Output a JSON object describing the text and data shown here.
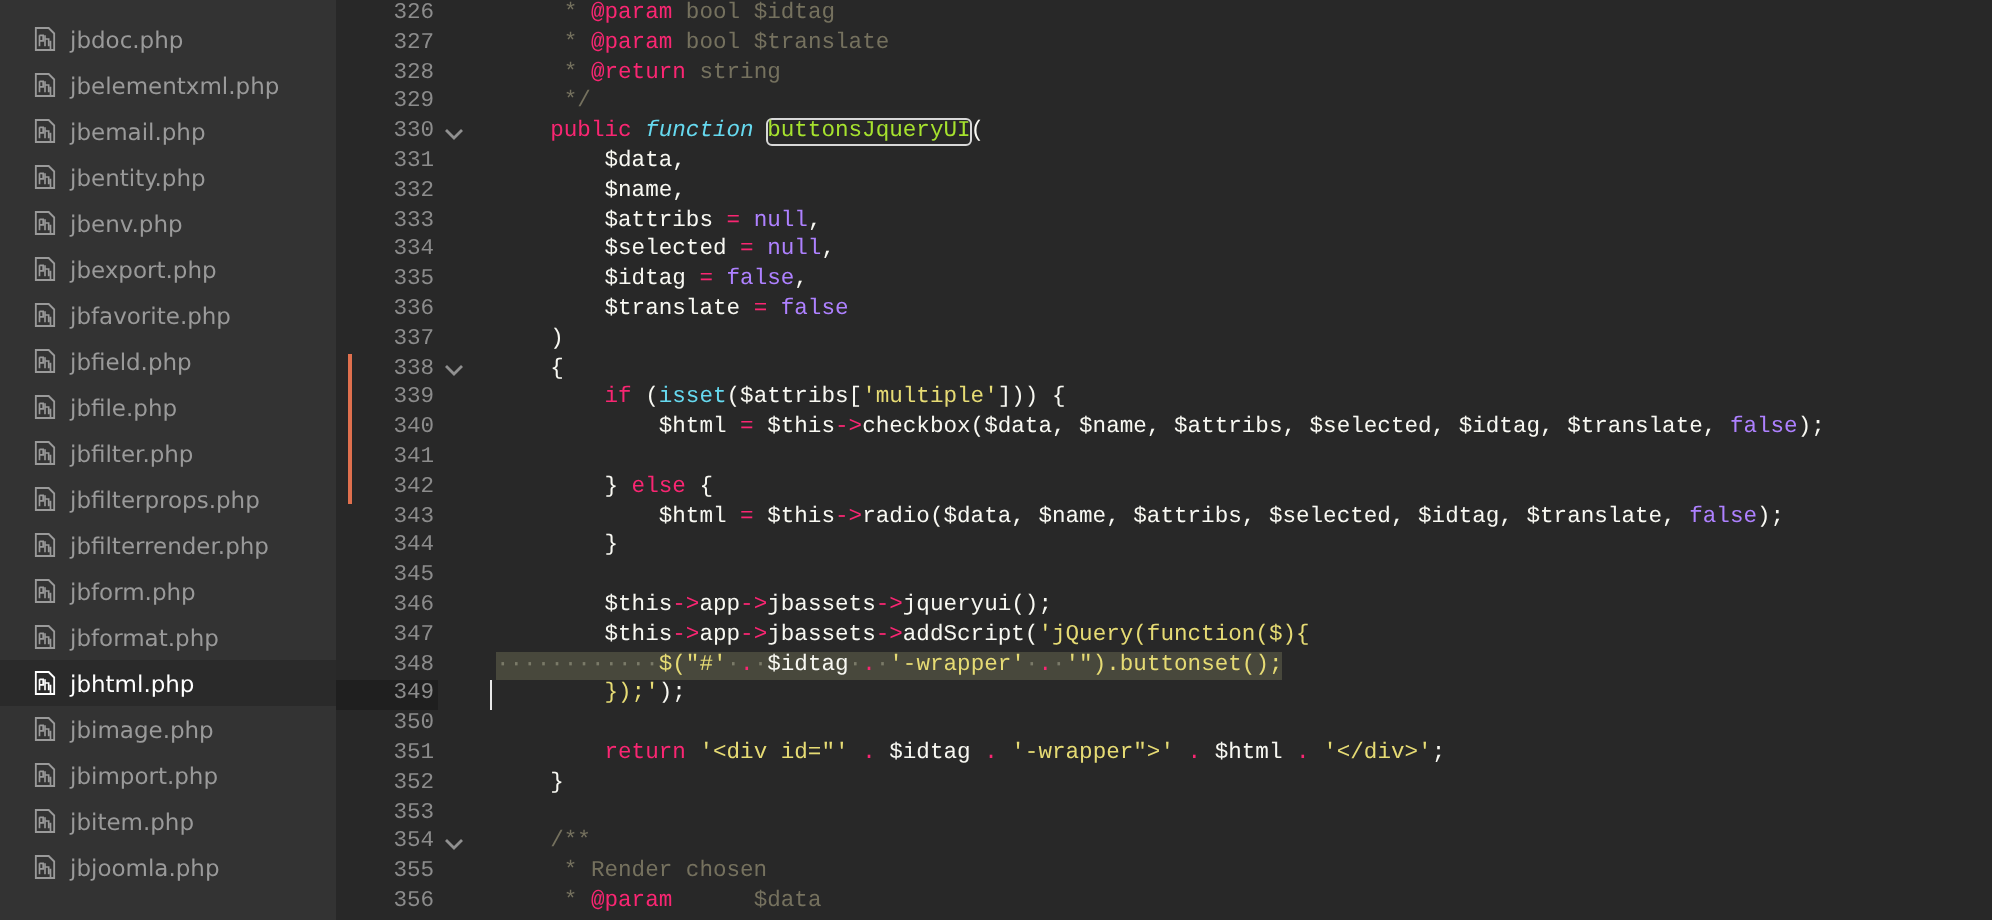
{
  "sidebar": {
    "items": [
      {
        "label": "jbdoc.php",
        "selected": false
      },
      {
        "label": "jbelementxml.php",
        "selected": false
      },
      {
        "label": "jbemail.php",
        "selected": false
      },
      {
        "label": "jbentity.php",
        "selected": false
      },
      {
        "label": "jbenv.php",
        "selected": false
      },
      {
        "label": "jbexport.php",
        "selected": false
      },
      {
        "label": "jbfavorite.php",
        "selected": false
      },
      {
        "label": "jbfield.php",
        "selected": false
      },
      {
        "label": "jbfile.php",
        "selected": false
      },
      {
        "label": "jbfilter.php",
        "selected": false
      },
      {
        "label": "jbfilterprops.php",
        "selected": false
      },
      {
        "label": "jbfilterrender.php",
        "selected": false
      },
      {
        "label": "jbform.php",
        "selected": false
      },
      {
        "label": "jbformat.php",
        "selected": false
      },
      {
        "label": "jbhtml.php",
        "selected": true
      },
      {
        "label": "jbimage.php",
        "selected": false
      },
      {
        "label": "jbimport.php",
        "selected": false
      },
      {
        "label": "jbitem.php",
        "selected": false
      },
      {
        "label": "jbjoomla.php",
        "selected": false
      }
    ]
  },
  "editor": {
    "lines": [
      {
        "number": "326",
        "fold": false,
        "modified": false,
        "selected": false,
        "current": false,
        "tokens": [
          {
            "kind": "comment",
            "text": "     * "
          },
          {
            "kind": "doctag",
            "text": "@param"
          },
          {
            "kind": "comment",
            "text": " bool $idtag"
          }
        ]
      },
      {
        "number": "327",
        "fold": false,
        "modified": false,
        "selected": false,
        "current": false,
        "tokens": [
          {
            "kind": "comment",
            "text": "     * "
          },
          {
            "kind": "doctag",
            "text": "@param"
          },
          {
            "kind": "comment",
            "text": " bool $translate"
          }
        ]
      },
      {
        "number": "328",
        "fold": false,
        "modified": false,
        "selected": false,
        "current": false,
        "tokens": [
          {
            "kind": "comment",
            "text": "     * "
          },
          {
            "kind": "doctag",
            "text": "@return"
          },
          {
            "kind": "comment",
            "text": " string"
          }
        ]
      },
      {
        "number": "329",
        "fold": false,
        "modified": false,
        "selected": false,
        "current": false,
        "tokens": [
          {
            "kind": "comment",
            "text": "     */"
          }
        ]
      },
      {
        "number": "330",
        "fold": true,
        "modified": false,
        "selected": false,
        "current": false,
        "tokens": [
          {
            "kind": "keyword",
            "text": "    public "
          },
          {
            "kind": "storage",
            "text": "function "
          },
          {
            "kind": "function",
            "text": "buttonsJqueryUI"
          },
          {
            "kind": "plain",
            "text": "("
          }
        ]
      },
      {
        "number": "331",
        "fold": false,
        "modified": false,
        "selected": false,
        "current": false,
        "tokens": [
          {
            "kind": "plain",
            "text": "        $data,"
          }
        ]
      },
      {
        "number": "332",
        "fold": false,
        "modified": false,
        "selected": false,
        "current": false,
        "tokens": [
          {
            "kind": "plain",
            "text": "        $name,"
          }
        ]
      },
      {
        "number": "333",
        "fold": false,
        "modified": false,
        "selected": false,
        "current": false,
        "tokens": [
          {
            "kind": "plain",
            "text": "        $attribs "
          },
          {
            "kind": "operator",
            "text": "= "
          },
          {
            "kind": "constant",
            "text": "null"
          },
          {
            "kind": "plain",
            "text": ","
          }
        ]
      },
      {
        "number": "334",
        "fold": false,
        "modified": false,
        "selected": false,
        "current": false,
        "tokens": [
          {
            "kind": "plain",
            "text": "        $selected "
          },
          {
            "kind": "operator",
            "text": "= "
          },
          {
            "kind": "constant",
            "text": "null"
          },
          {
            "kind": "plain",
            "text": ","
          }
        ]
      },
      {
        "number": "335",
        "fold": false,
        "modified": false,
        "selected": false,
        "current": false,
        "tokens": [
          {
            "kind": "plain",
            "text": "        $idtag "
          },
          {
            "kind": "operator",
            "text": "= "
          },
          {
            "kind": "constant",
            "text": "false"
          },
          {
            "kind": "plain",
            "text": ","
          }
        ]
      },
      {
        "number": "336",
        "fold": false,
        "modified": false,
        "selected": false,
        "current": false,
        "tokens": [
          {
            "kind": "plain",
            "text": "        $translate "
          },
          {
            "kind": "operator",
            "text": "= "
          },
          {
            "kind": "constant",
            "text": "false"
          }
        ]
      },
      {
        "number": "337",
        "fold": false,
        "modified": false,
        "selected": false,
        "current": false,
        "tokens": [
          {
            "kind": "plain",
            "text": "    )"
          }
        ]
      },
      {
        "number": "338",
        "fold": true,
        "modified": true,
        "selected": false,
        "current": false,
        "tokens": [
          {
            "kind": "plain",
            "text": "    {"
          }
        ]
      },
      {
        "number": "339",
        "fold": false,
        "modified": true,
        "selected": false,
        "current": false,
        "tokens": [
          {
            "kind": "keyword",
            "text": "        if "
          },
          {
            "kind": "plain",
            "text": "("
          },
          {
            "kind": "support",
            "text": "isset"
          },
          {
            "kind": "plain",
            "text": "($attribs["
          },
          {
            "kind": "string",
            "text": "'multiple'"
          },
          {
            "kind": "plain",
            "text": "])) {"
          }
        ]
      },
      {
        "number": "340",
        "fold": false,
        "modified": true,
        "selected": false,
        "current": false,
        "tokens": [
          {
            "kind": "plain",
            "text": "            $html "
          },
          {
            "kind": "operator",
            "text": "="
          },
          {
            "kind": "plain",
            "text": " $this"
          },
          {
            "kind": "operator",
            "text": "->"
          },
          {
            "kind": "plain",
            "text": "checkbox($data, $name, $attribs, $selected, $idtag, $translate, "
          },
          {
            "kind": "constant",
            "text": "false"
          },
          {
            "kind": "plain",
            "text": ");"
          }
        ]
      },
      {
        "number": "341",
        "fold": false,
        "modified": true,
        "selected": false,
        "current": false
      },
      {
        "number": "342",
        "fold": false,
        "modified": true,
        "selected": false,
        "current": false,
        "tokens": [
          {
            "kind": "plain",
            "text": "        } "
          },
          {
            "kind": "keyword",
            "text": "else"
          },
          {
            "kind": "plain",
            "text": " {"
          }
        ]
      },
      {
        "number": "343",
        "fold": false,
        "modified": false,
        "selected": false,
        "current": false,
        "tokens": [
          {
            "kind": "plain",
            "text": "            $html "
          },
          {
            "kind": "operator",
            "text": "="
          },
          {
            "kind": "plain",
            "text": " $this"
          },
          {
            "kind": "operator",
            "text": "->"
          },
          {
            "kind": "plain",
            "text": "radio($data, $name, $attribs, $selected, $idtag, $translate, "
          },
          {
            "kind": "constant",
            "text": "false"
          },
          {
            "kind": "plain",
            "text": ");"
          }
        ]
      },
      {
        "number": "344",
        "fold": false,
        "modified": false,
        "selected": false,
        "current": false,
        "tokens": [
          {
            "kind": "plain",
            "text": "        }"
          }
        ]
      },
      {
        "number": "345",
        "fold": false,
        "modified": false,
        "selected": false,
        "current": false
      },
      {
        "number": "346",
        "fold": false,
        "modified": false,
        "selected": false,
        "current": false,
        "tokens": [
          {
            "kind": "plain",
            "text": "        $this"
          },
          {
            "kind": "operator",
            "text": "->"
          },
          {
            "kind": "plain",
            "text": "app"
          },
          {
            "kind": "operator",
            "text": "->"
          },
          {
            "kind": "plain",
            "text": "jbassets"
          },
          {
            "kind": "operator",
            "text": "->"
          },
          {
            "kind": "plain",
            "text": "jqueryui();"
          }
        ]
      },
      {
        "number": "347",
        "fold": false,
        "modified": false,
        "selected": false,
        "current": false,
        "tokens": [
          {
            "kind": "plain",
            "text": "        $this"
          },
          {
            "kind": "operator",
            "text": "->"
          },
          {
            "kind": "plain",
            "text": "app"
          },
          {
            "kind": "operator",
            "text": "->"
          },
          {
            "kind": "plain",
            "text": "jbassets"
          },
          {
            "kind": "operator",
            "text": "->"
          },
          {
            "kind": "plain",
            "text": "addScript("
          },
          {
            "kind": "string",
            "text": "'jQuery(function($){"
          }
        ]
      },
      {
        "number": "348",
        "fold": false,
        "modified": false,
        "selected": true,
        "current": false,
        "tokens": [
          {
            "kind": "whitespace",
            "text": "············"
          },
          {
            "kind": "string",
            "text": "$(\"#'"
          },
          {
            "kind": "whitespace",
            "text": "·"
          },
          {
            "kind": "operator",
            "text": "."
          },
          {
            "kind": "whitespace",
            "text": "·"
          },
          {
            "kind": "plain",
            "text": "$idtag"
          },
          {
            "kind": "whitespace",
            "text": "·"
          },
          {
            "kind": "operator",
            "text": "."
          },
          {
            "kind": "whitespace",
            "text": "·"
          },
          {
            "kind": "string",
            "text": "'-wrapper'"
          },
          {
            "kind": "whitespace",
            "text": "·"
          },
          {
            "kind": "operator",
            "text": "."
          },
          {
            "kind": "whitespace",
            "text": "·"
          },
          {
            "kind": "string",
            "text": "'\").buttonset();"
          }
        ]
      },
      {
        "number": "349",
        "fold": false,
        "modified": false,
        "selected": false,
        "current": true,
        "tokens": [
          {
            "kind": "string",
            "text": "        });'"
          },
          {
            "kind": "plain",
            "text": ");"
          }
        ]
      },
      {
        "number": "350",
        "fold": false,
        "modified": false,
        "selected": false,
        "current": false
      },
      {
        "number": "351",
        "fold": false,
        "modified": false,
        "selected": false,
        "current": false,
        "tokens": [
          {
            "kind": "keyword",
            "text": "        return "
          },
          {
            "kind": "string",
            "text": "'<div id=\"' "
          },
          {
            "kind": "operator",
            "text": "."
          },
          {
            "kind": "plain",
            "text": " $idtag "
          },
          {
            "kind": "operator",
            "text": ". "
          },
          {
            "kind": "string",
            "text": "'-wrapper\">' "
          },
          {
            "kind": "operator",
            "text": "."
          },
          {
            "kind": "plain",
            "text": " $html "
          },
          {
            "kind": "operator",
            "text": ". "
          },
          {
            "kind": "string",
            "text": "'</div>'"
          },
          {
            "kind": "plain",
            "text": ";"
          }
        ]
      },
      {
        "number": "352",
        "fold": false,
        "modified": false,
        "selected": false,
        "current": false,
        "tokens": [
          {
            "kind": "plain",
            "text": "    }"
          }
        ]
      },
      {
        "number": "353",
        "fold": false,
        "modified": false,
        "selected": false,
        "current": false
      },
      {
        "number": "354",
        "fold": true,
        "modified": false,
        "selected": false,
        "current": false,
        "tokens": [
          {
            "kind": "comment",
            "text": "    /**"
          }
        ]
      },
      {
        "number": "355",
        "fold": false,
        "modified": false,
        "selected": false,
        "current": false,
        "tokens": [
          {
            "kind": "comment",
            "text": "     * Render chosen"
          }
        ]
      },
      {
        "number": "356",
        "fold": false,
        "modified": false,
        "selected": false,
        "current": false,
        "tokens": [
          {
            "kind": "comment",
            "text": "     * "
          },
          {
            "kind": "doctag",
            "text": "@param"
          },
          {
            "kind": "comment",
            "text": "      $data"
          }
        ]
      }
    ]
  }
}
